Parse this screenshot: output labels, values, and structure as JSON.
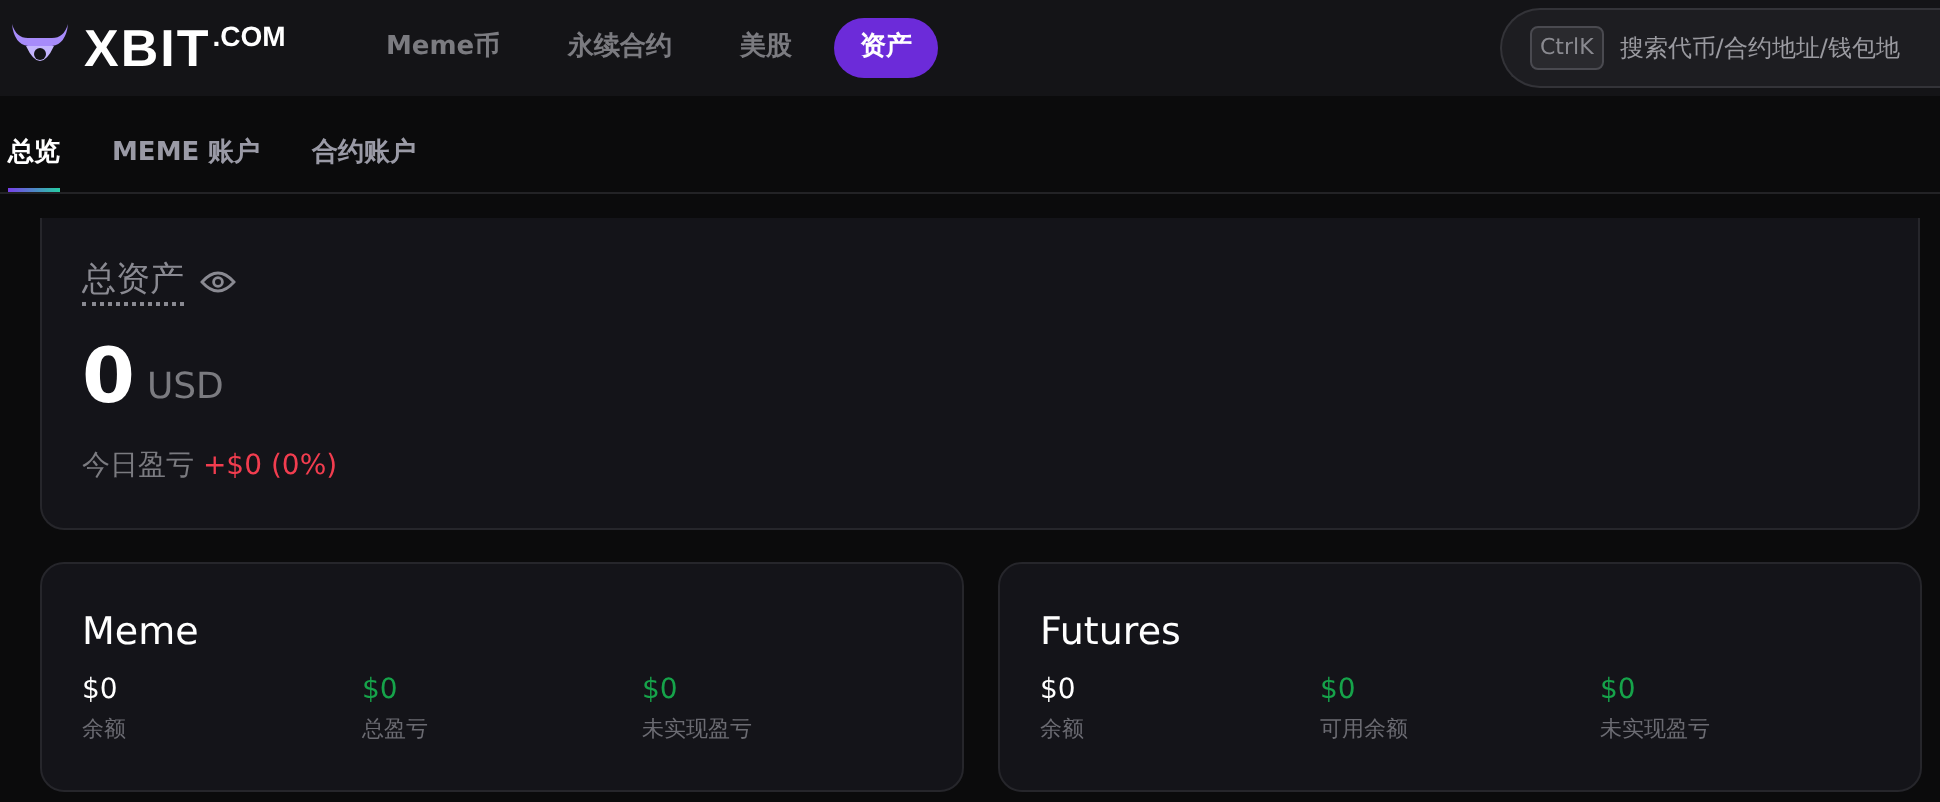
{
  "header": {
    "logo": {
      "name": "XBIT",
      "suffix": ".COM"
    },
    "nav": [
      {
        "label": "Meme币",
        "selected": false
      },
      {
        "label": "永续合约",
        "selected": false
      },
      {
        "label": "美股",
        "selected": false
      },
      {
        "label": "资产",
        "selected": true
      }
    ],
    "search": {
      "shortcut": "CtrlK",
      "placeholder": "搜索代币/合约地址/钱包地"
    }
  },
  "tabs": [
    {
      "label": "总览",
      "selected": true
    },
    {
      "label": "MEME 账户",
      "selected": false
    },
    {
      "label": "合约账户",
      "selected": false
    }
  ],
  "summary": {
    "title": "总资产",
    "amount": "0",
    "currency": "USD",
    "pnl_label": "今日盈亏",
    "pnl_value": "+$0 (0%)"
  },
  "accounts": [
    {
      "title": "Meme",
      "stats": [
        {
          "value": "$0",
          "label": "余额",
          "kind": "neutral"
        },
        {
          "value": "$0",
          "label": "总盈亏",
          "kind": "gain"
        },
        {
          "value": "$0",
          "label": "未实现盈亏",
          "kind": "gain"
        }
      ]
    },
    {
      "title": "Futures",
      "stats": [
        {
          "value": "$0",
          "label": "余额",
          "kind": "neutral"
        },
        {
          "value": "$0",
          "label": "可用余额",
          "kind": "gain"
        },
        {
          "value": "$0",
          "label": "未实现盈亏",
          "kind": "gain"
        }
      ]
    }
  ]
}
